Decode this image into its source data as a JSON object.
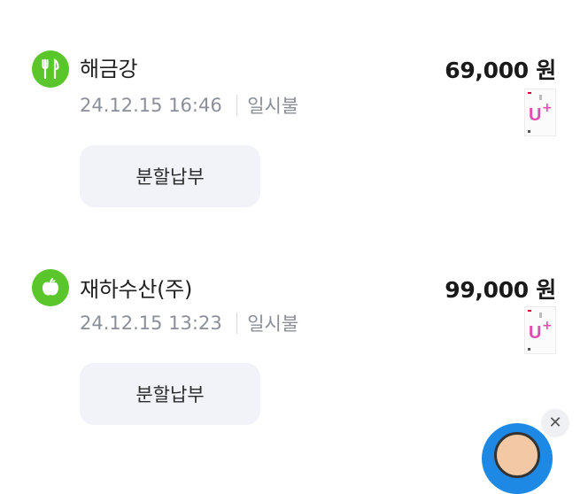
{
  "transactions": [
    {
      "category_icon": "fork-knife-icon",
      "category_color": "#5ac62c",
      "merchant": "해금강",
      "datetime": "24.12.15 16:46",
      "payment_type": "일시불",
      "amount": "69,000 원",
      "card_icon": "lg-uplus-card-icon",
      "button_label": "분할납부"
    },
    {
      "category_icon": "apple-icon",
      "category_color": "#5ac62c",
      "merchant": "재하수산(주)",
      "datetime": "24.12.15 13:23",
      "payment_type": "일시불",
      "amount": "99,000 원",
      "card_icon": "lg-uplus-card-icon",
      "button_label": "분할납부"
    }
  ],
  "floating": {
    "close_symbol": "✕",
    "avatar_icon": "chatbot-avatar-icon",
    "avatar_color": "#1e88e5"
  }
}
